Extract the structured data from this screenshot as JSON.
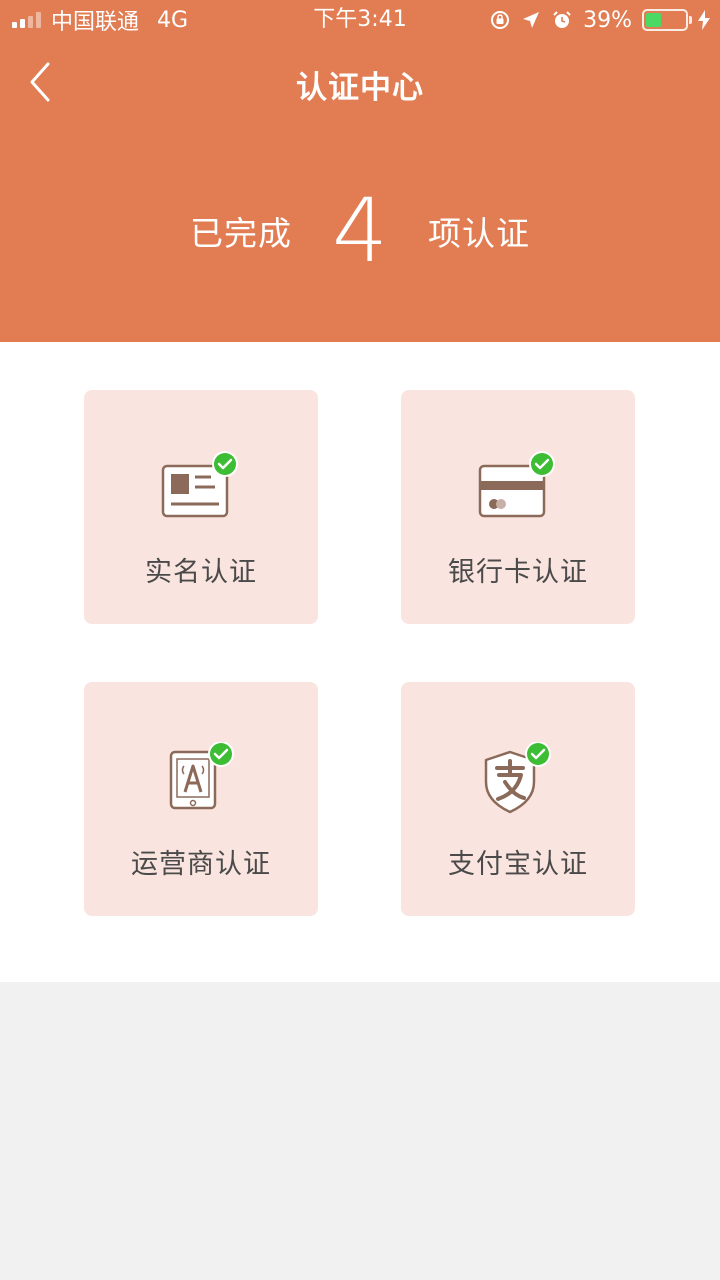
{
  "status_bar": {
    "carrier": "中国联通",
    "network": "4G",
    "time": "下午3:41",
    "battery_percent": "39%",
    "battery_level": 0.39,
    "battery_color": "#4cd964"
  },
  "nav": {
    "title": "认证中心",
    "back_icon": "chevron-left-icon"
  },
  "summary": {
    "prefix": "已完成",
    "count": "4",
    "suffix": "项认证"
  },
  "theme": {
    "header_color": "#e27c53",
    "card_color": "#fae4df",
    "check_color": "#3dbd34"
  },
  "cards": [
    {
      "label": "实名认证",
      "icon": "id-card-icon",
      "verified": true
    },
    {
      "label": "银行卡认证",
      "icon": "bank-card-icon",
      "verified": true
    },
    {
      "label": "运营商认证",
      "icon": "phone-carrier-icon",
      "verified": true
    },
    {
      "label": "支付宝认证",
      "icon": "alipay-shield-icon",
      "verified": true
    }
  ]
}
